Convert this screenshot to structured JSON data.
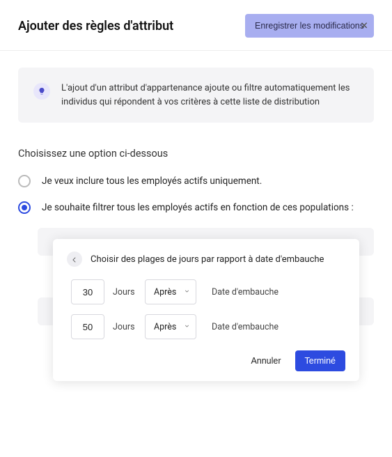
{
  "header": {
    "title": "Ajouter des règles d'attribut",
    "save_label": "Enregistrer les modifications"
  },
  "info": {
    "text": "L'ajout d'un attribut d'appartenance ajoute ou filtre automatiquement les individus qui répondent à vos critères à cette liste de distribution"
  },
  "section": {
    "label": "Choisissez une option ci-dessous",
    "options": [
      {
        "label": "Je veux inclure tous les employés actifs uniquement.",
        "selected": false
      },
      {
        "label": "Je souhaite filtrer tous les employés actifs en fonction de ces populations :",
        "selected": true
      }
    ]
  },
  "popover": {
    "title": "Choisir des plages de jours par rapport à date d'embauche",
    "rows": [
      {
        "value": "30",
        "unit": "Jours",
        "relation": "Après",
        "reference": "Date d'embauche"
      },
      {
        "value": "50",
        "unit": "Jours",
        "relation": "Après",
        "reference": "Date d'embauche"
      }
    ],
    "cancel_label": "Annuler",
    "done_label": "Terminé"
  }
}
